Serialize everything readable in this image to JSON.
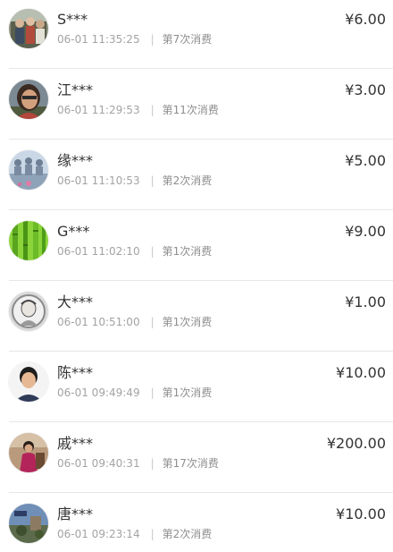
{
  "records": [
    {
      "name": "S***",
      "time": "06-01 11:35:25",
      "separator": "|",
      "count": "第7次消费",
      "amount": "¥6.00",
      "avatar": "group-photo-avatar"
    },
    {
      "name": "江***",
      "time": "06-01 11:29:53",
      "separator": "|",
      "count": "第11次消费",
      "amount": "¥3.00",
      "avatar": "portrait-woman-avatar"
    },
    {
      "name": "缘***",
      "time": "06-01 11:10:53",
      "separator": "|",
      "count": "第2次消费",
      "amount": "¥5.00",
      "avatar": "buddha-statues-avatar"
    },
    {
      "name": "G***",
      "time": "06-01 11:02:10",
      "separator": "|",
      "count": "第1次消费",
      "amount": "¥9.00",
      "avatar": "bamboo-avatar"
    },
    {
      "name": "大***",
      "time": "06-01 10:51:00",
      "separator": "|",
      "count": "第1次消费",
      "amount": "¥1.00",
      "avatar": "sketch-portrait-avatar"
    },
    {
      "name": "陈***",
      "time": "06-01 09:49:49",
      "separator": "|",
      "count": "第1次消费",
      "amount": "¥10.00",
      "avatar": "person-photo-avatar"
    },
    {
      "name": "戚***",
      "time": "06-01 09:40:31",
      "separator": "|",
      "count": "第17次消费",
      "amount": "¥200.00",
      "avatar": "woman-outdoor-avatar"
    },
    {
      "name": "唐***",
      "time": "06-01 09:23:14",
      "separator": "|",
      "count": "第2次消费",
      "amount": "¥10.00",
      "avatar": "landscape-avatar"
    }
  ]
}
